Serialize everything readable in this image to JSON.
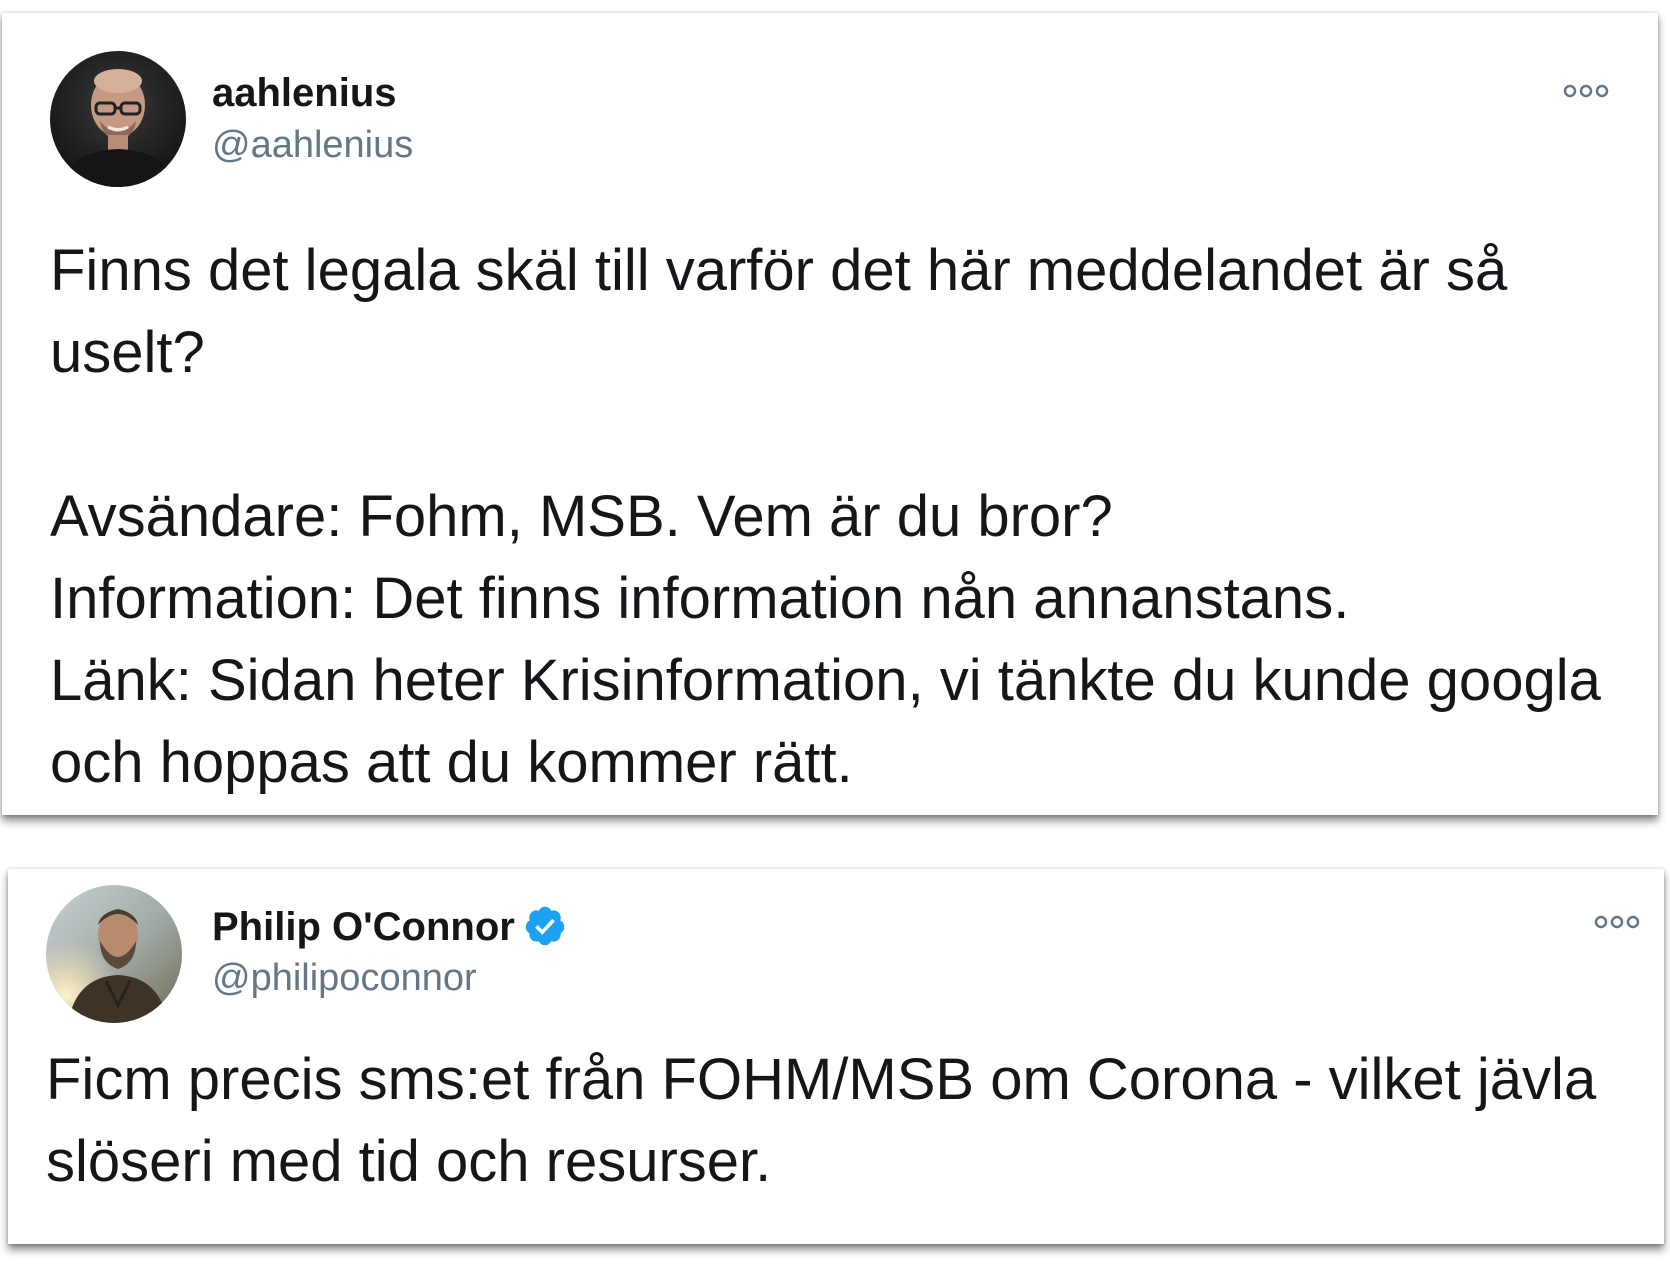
{
  "tweets": [
    {
      "display_name": "aahlenius",
      "handle": "@aahlenius",
      "verified": false,
      "avatar_icon": "user-avatar-photo",
      "more_icon": "more-options-icon",
      "text": "Finns det legala skäl till varför det här meddelandet är så uselt?\n\nAvsändare: Fohm, MSB. Vem är du bror?\nInformation: Det finns information nån annanstans.\nLänk: Sidan heter Krisinformation, vi tänkte du kunde googla och hoppas att du kommer rätt."
    },
    {
      "display_name": "Philip O'Connor",
      "handle": "@philipoconnor",
      "verified": true,
      "avatar_icon": "user-avatar-photo",
      "verified_icon": "verified-badge-icon",
      "more_icon": "more-options-icon",
      "text": "Ficm precis sms:et från FOHM/MSB om Corona - vilket jävla slöseri med tid och resurser."
    }
  ],
  "colors": {
    "text_primary": "#14171a",
    "text_secondary": "#657786",
    "verified_blue": "#1da1f2",
    "background": "#ffffff"
  }
}
